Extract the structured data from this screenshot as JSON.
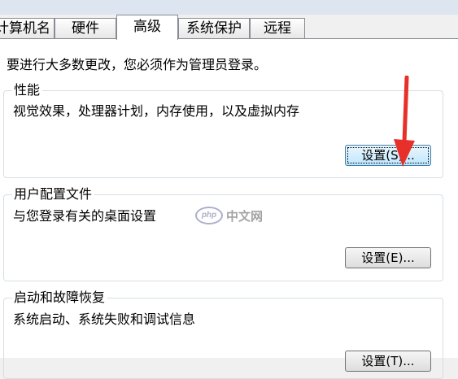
{
  "tabs": [
    {
      "label": "计算机名",
      "visible_label": "计算机名"
    },
    {
      "label": "硬件"
    },
    {
      "label": "高级"
    },
    {
      "label": "系统保护"
    },
    {
      "label": "远程"
    }
  ],
  "active_tab": "高级",
  "notice": "要进行大多数更改，您必须作为管理员登录。",
  "performance": {
    "title": "性能",
    "description": "视觉效果，处理器计划，内存使用，以及虚拟内存",
    "button_label": "设置(S)..."
  },
  "user_profiles": {
    "title": "用户配置文件",
    "description": "与您登录有关的桌面设置",
    "button_label": "设置(E)..."
  },
  "startup_recovery": {
    "title": "启动和故障恢复",
    "description": "系统启动、系统失败和调试信息",
    "button_label": "设置(T)..."
  },
  "annotation": {
    "arrow_color": "#e8302a"
  },
  "watermark": {
    "logo_text": "php",
    "site_text": "中文网"
  }
}
